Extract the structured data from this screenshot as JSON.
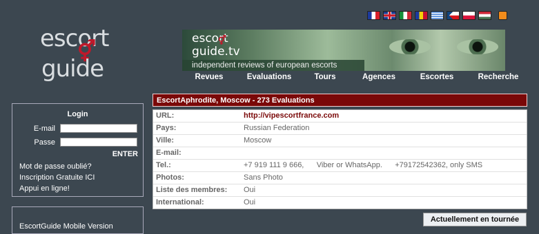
{
  "flags": [
    {
      "name": "french-flag-icon",
      "colors": [
        "#1c3a9e",
        "#ffffff",
        "#d8202a"
      ]
    },
    {
      "name": "uk-flag-icon",
      "colors": [
        "#1c3a8e",
        "#ffffff",
        "#cc1f2d"
      ]
    },
    {
      "name": "italian-flag-icon",
      "colors": [
        "#15903a",
        "#ffffff",
        "#ce2b37"
      ]
    },
    {
      "name": "romanian-flag-icon",
      "colors": [
        "#1c3a9e",
        "#f3d20a",
        "#c8102e"
      ]
    },
    {
      "name": "greek-flag-icon",
      "colors": [
        "#3a7bd5",
        "#ffffff",
        "#3a7bd5"
      ]
    },
    {
      "name": "czech-flag-icon",
      "colors": [
        "#ffffff",
        "#d7141a",
        "#11457e"
      ]
    },
    {
      "name": "polish-flag-icon",
      "colors": [
        "#ffffff",
        "#ffffff",
        "#dc143c"
      ]
    },
    {
      "name": "hungarian-flag-icon",
      "colors": [
        "#ce2939",
        "#ffffff",
        "#477050"
      ]
    },
    {
      "name": "rss-icon",
      "colors": [
        "#f28c1b",
        "#f28c1b",
        "#f28c1b"
      ]
    }
  ],
  "logo": {
    "line1": "escort",
    "line2": "guide",
    "symbol": "⚥"
  },
  "banner": {
    "line1": "escort",
    "line2": "guide.tv",
    "symbol": "⚥",
    "tagline": "independent reviews of european escorts"
  },
  "nav": [
    "Revues",
    "Evaluations",
    "Tours",
    "Agences",
    "Escortes",
    "Recherche"
  ],
  "listing_title": "EscortAphrodite, Moscow - 273 Evaluations",
  "info_rows": [
    {
      "label": "URL:",
      "value": "http://vipescortfrance.com",
      "link": true
    },
    {
      "label": "Pays:",
      "value": "Russian Federation"
    },
    {
      "label": "Ville:",
      "value": "Moscow"
    },
    {
      "label": "E-mail:",
      "value": ""
    },
    {
      "label": "Tel.:",
      "value": "+7 919 111 9 666,      Viber or WhatsApp.      +79172542362, only SMS"
    },
    {
      "label": "Photos:",
      "value": "Sans Photo"
    },
    {
      "label": "Liste des membres:",
      "value": "Oui"
    },
    {
      "label": "International:",
      "value": "Oui"
    }
  ],
  "login": {
    "title": "Login",
    "email_label": "E-mail",
    "password_label": "Passe",
    "email_value": "",
    "password_value": "",
    "enter_label": "ENTER",
    "links": [
      "Mot de passe oublié?",
      "Inscription Gratuite ICI",
      "Appui en ligne!"
    ]
  },
  "mobile": "EscortGuide Mobile Version",
  "now_touring": "Actuellement en tournée",
  "colors": {
    "background": "#3c4750",
    "accent": "#7a0808"
  }
}
